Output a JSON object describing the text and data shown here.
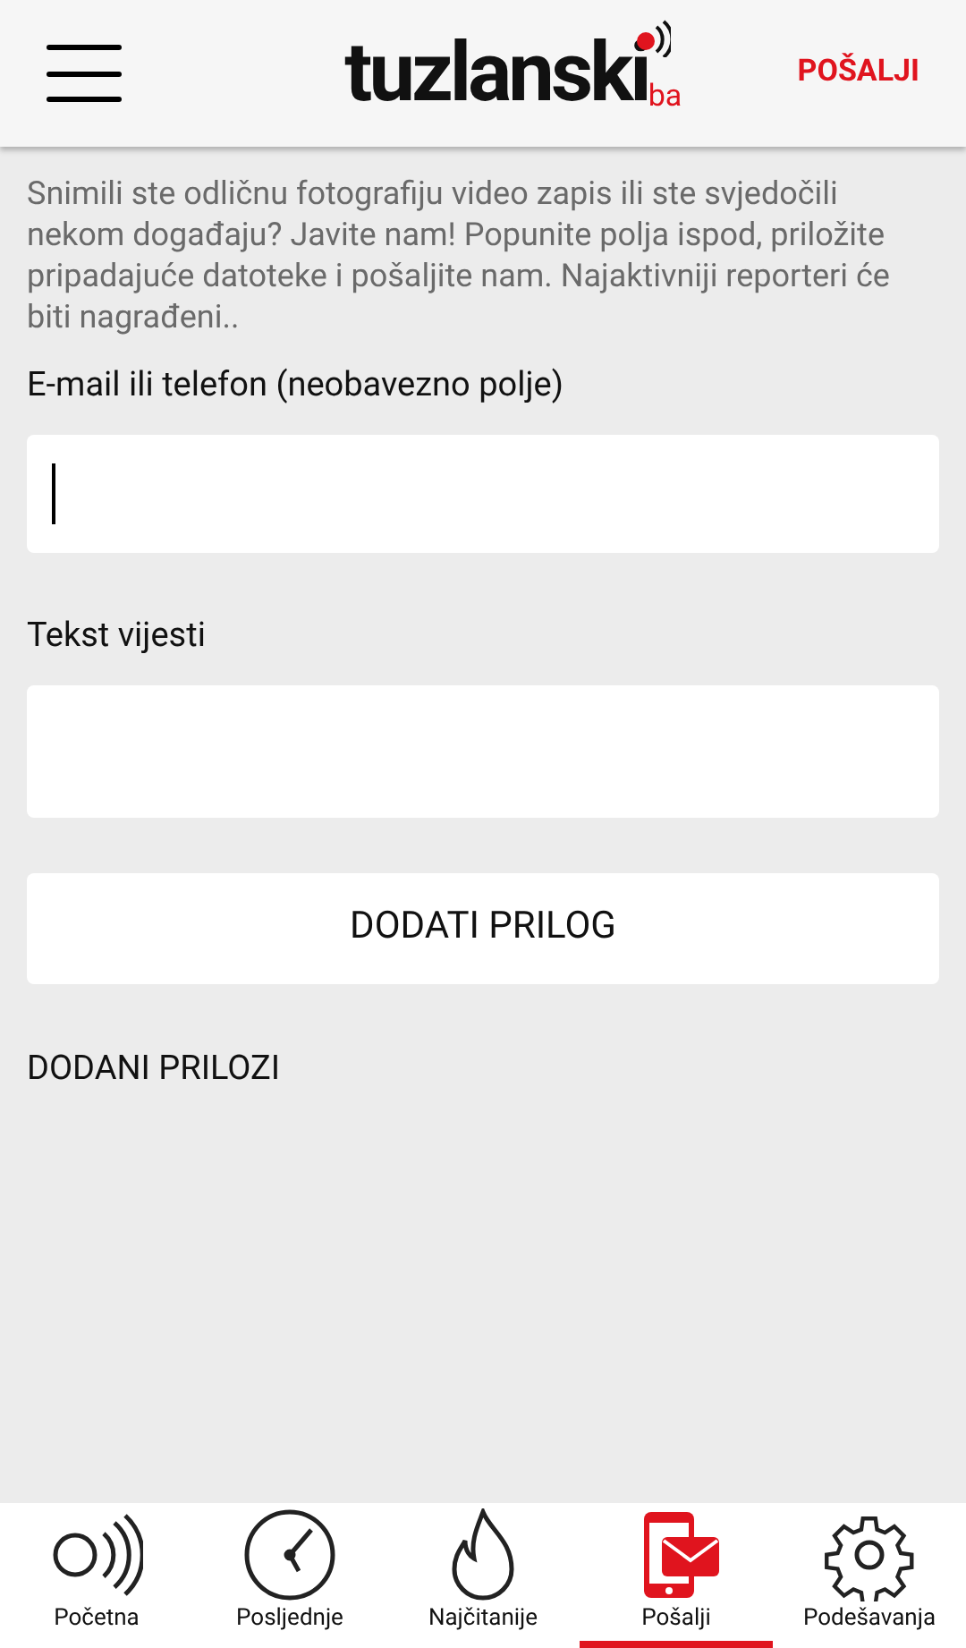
{
  "header": {
    "logo": {
      "name": "tuzlanski",
      "suffix": "ba"
    },
    "action": "POŠALJI"
  },
  "intro": "Snimili ste odličnu fotografiju video zapis ili ste svjedočili nekom događaju? Javite nam! Popunite polja ispod, priložite pripadajuće datoteke i pošaljite nam. Najaktivniji reporteri će biti nagrađeni..",
  "fields": [
    {
      "label": "E-mail ili telefon (neobavezno polje)",
      "focused": true
    },
    {
      "label": "Tekst vijesti",
      "focused": false
    }
  ],
  "attach_button": "DODATI PRILOG",
  "attachments_heading": "DODANI PRILOZI",
  "tabs": [
    {
      "kind": "home",
      "label": "Početna",
      "selected": false
    },
    {
      "kind": "recent",
      "label": "Posljednje",
      "selected": false
    },
    {
      "kind": "popular",
      "label": "Najčitanije",
      "selected": false
    },
    {
      "kind": "send",
      "label": "Pošalji",
      "selected": true
    },
    {
      "kind": "settings",
      "label": "Podešavanja",
      "selected": false
    }
  ]
}
